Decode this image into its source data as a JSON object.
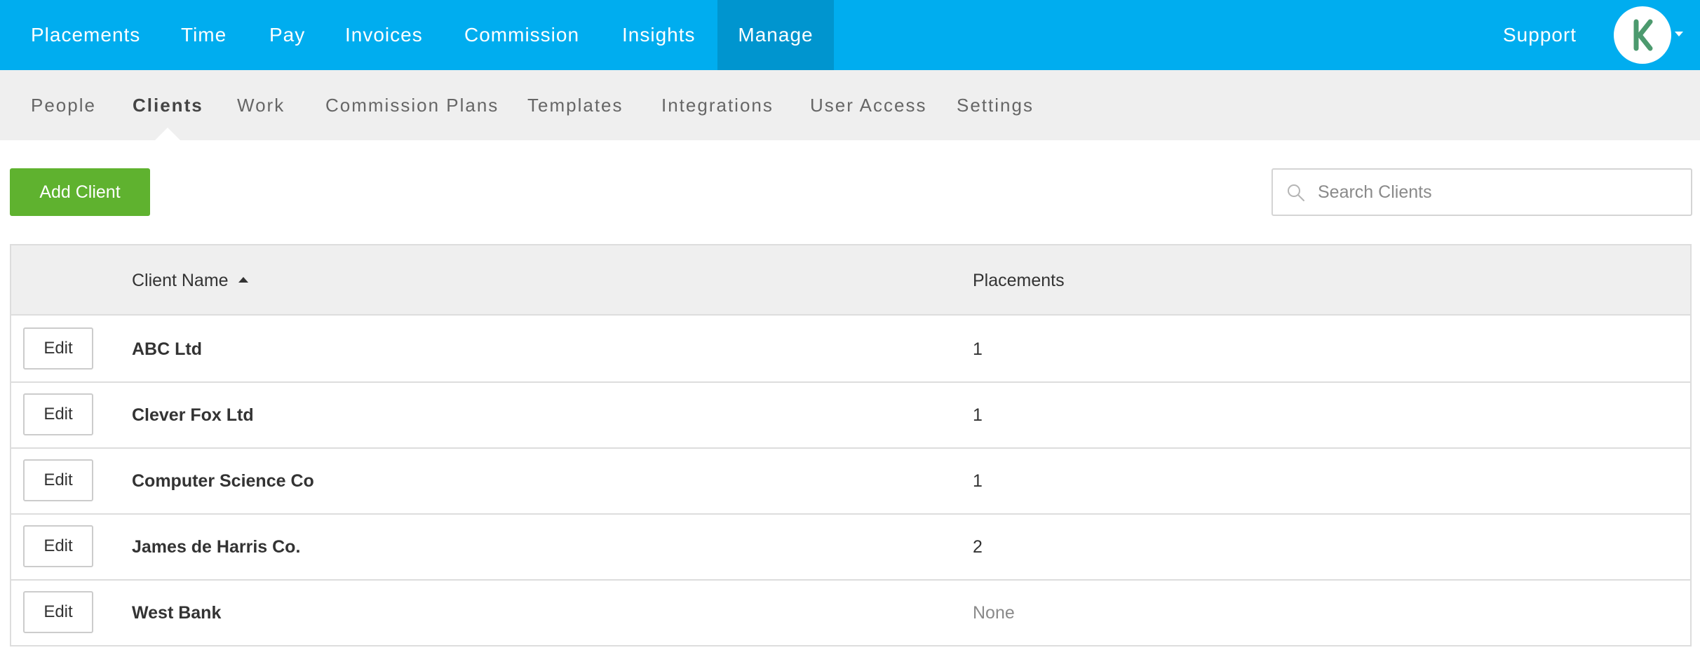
{
  "topnav": {
    "items": [
      {
        "label": "Placements"
      },
      {
        "label": "Time"
      },
      {
        "label": "Pay"
      },
      {
        "label": "Invoices"
      },
      {
        "label": "Commission"
      },
      {
        "label": "Insights"
      },
      {
        "label": "Manage",
        "active": true
      }
    ],
    "support": "Support",
    "avatar_icon": "k-logo-icon"
  },
  "subnav": {
    "items": [
      {
        "label": "People"
      },
      {
        "label": "Clients",
        "active": true
      },
      {
        "label": "Work"
      },
      {
        "label": "Commission Plans"
      },
      {
        "label": "Templates"
      },
      {
        "label": "Integrations"
      },
      {
        "label": "User Access"
      },
      {
        "label": "Settings"
      }
    ]
  },
  "actions": {
    "add_label": "Add Client",
    "search_placeholder": "Search Clients",
    "search_value": ""
  },
  "table": {
    "columns": {
      "name": "Client Name",
      "placements": "Placements"
    },
    "sort": {
      "column": "name",
      "direction": "asc"
    },
    "edit_label": "Edit",
    "rows": [
      {
        "name": "ABC Ltd",
        "placements": "1"
      },
      {
        "name": "Clever Fox Ltd",
        "placements": "1"
      },
      {
        "name": "Computer Science Co",
        "placements": "1"
      },
      {
        "name": "James de Harris Co.",
        "placements": "2"
      },
      {
        "name": "West Bank",
        "placements": "None"
      }
    ]
  },
  "colors": {
    "topnav_bg": "#00adef",
    "topnav_active_bg": "#0095cf",
    "subnav_bg": "#efefef",
    "add_button": "#5fb22f",
    "logo_green": "#4c9a6e"
  }
}
